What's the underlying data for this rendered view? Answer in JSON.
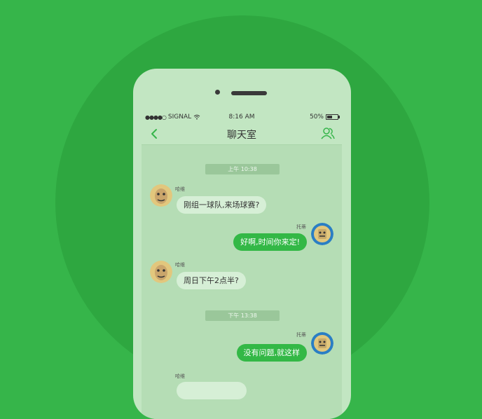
{
  "status_bar": {
    "carrier": "SIGNAL",
    "time": "8:16 AM",
    "battery": "50%",
    "battery_level": 0.5
  },
  "nav": {
    "title": "聊天室",
    "back_icon": "chevron-left-icon",
    "members_icon": "group-icon"
  },
  "timestamps": [
    "上午 10:38",
    "下午 13:38"
  ],
  "messages": [
    {
      "sender": "哈维",
      "text": "刚组一球队,来场球赛?",
      "direction": "incoming"
    },
    {
      "sender": "托蒂",
      "text": "好啊,时间你来定!",
      "direction": "outgoing"
    },
    {
      "sender": "哈维",
      "text": "周日下午2点半?",
      "direction": "incoming"
    },
    {
      "sender": "托蒂",
      "text": "没有问题,就这样",
      "direction": "outgoing"
    },
    {
      "sender": "哈维",
      "text": "",
      "direction": "incoming"
    }
  ],
  "colors": {
    "background": "#36b54a",
    "circle": "#2ea740",
    "phone": "#c2e6c2",
    "screen": "#b5ddb5",
    "outgoing_bubble": "#33b846",
    "incoming_bubble": "#d6efd6"
  }
}
